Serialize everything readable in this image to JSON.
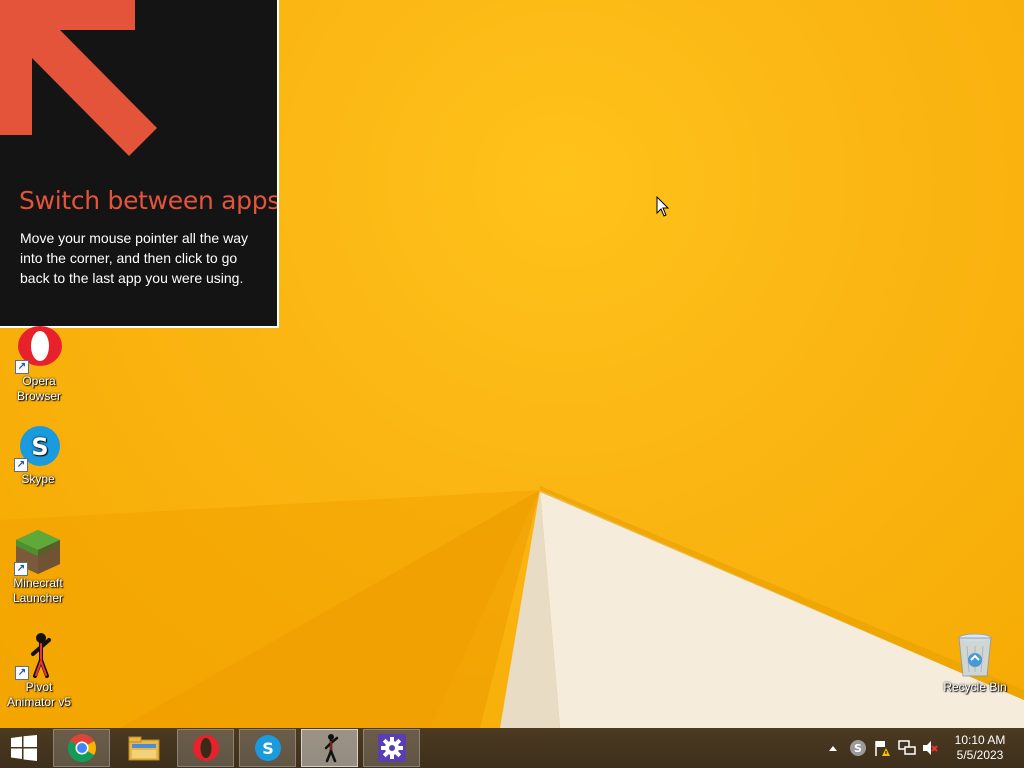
{
  "tip": {
    "title": "Switch between apps",
    "body": "Move your mouse pointer all the way into the corner, and then click to go back to the last app you were using.",
    "title_color": "#e3543a",
    "arrow_color": "#e3543a",
    "icon": "up-left-arrow-icon"
  },
  "desktop_icons": [
    {
      "label_line1": "Opera",
      "label_line2": "Browser",
      "icon": "opera-icon"
    },
    {
      "label_line1": "Skype",
      "label_line2": "",
      "icon": "skype-icon"
    },
    {
      "label_line1": "Minecraft",
      "label_line2": "Launcher",
      "icon": "minecraft-icon"
    },
    {
      "label_line1": "Pivot",
      "label_line2": "Animator v5",
      "icon": "pivot-stickman-icon"
    },
    {
      "label_line1": "Recycle Bin",
      "label_line2": "",
      "icon": "recycle-bin-icon"
    }
  ],
  "taskbar": {
    "start_icon": "windows-logo-icon",
    "pinned": [
      {
        "name": "Google Chrome",
        "icon": "chrome-icon"
      },
      {
        "name": "File Explorer",
        "icon": "folder-icon"
      },
      {
        "name": "Opera",
        "icon": "opera-icon"
      },
      {
        "name": "Skype",
        "icon": "skype-icon"
      },
      {
        "name": "Pivot Animator",
        "icon": "pivot-stickman-icon"
      },
      {
        "name": "Settings",
        "icon": "gear-icon"
      }
    ],
    "tray_icons": [
      "show-hidden-icons-chevron",
      "skype-tray-icon",
      "action-center-flag-icon",
      "network-icon",
      "volume-muted-icon"
    ],
    "clock_time": "10:10 AM",
    "clock_date": "5/5/2023"
  },
  "colors": {
    "wallpaper": "#f7b500",
    "taskbar": "#45351f",
    "tip_background": "#141414"
  }
}
